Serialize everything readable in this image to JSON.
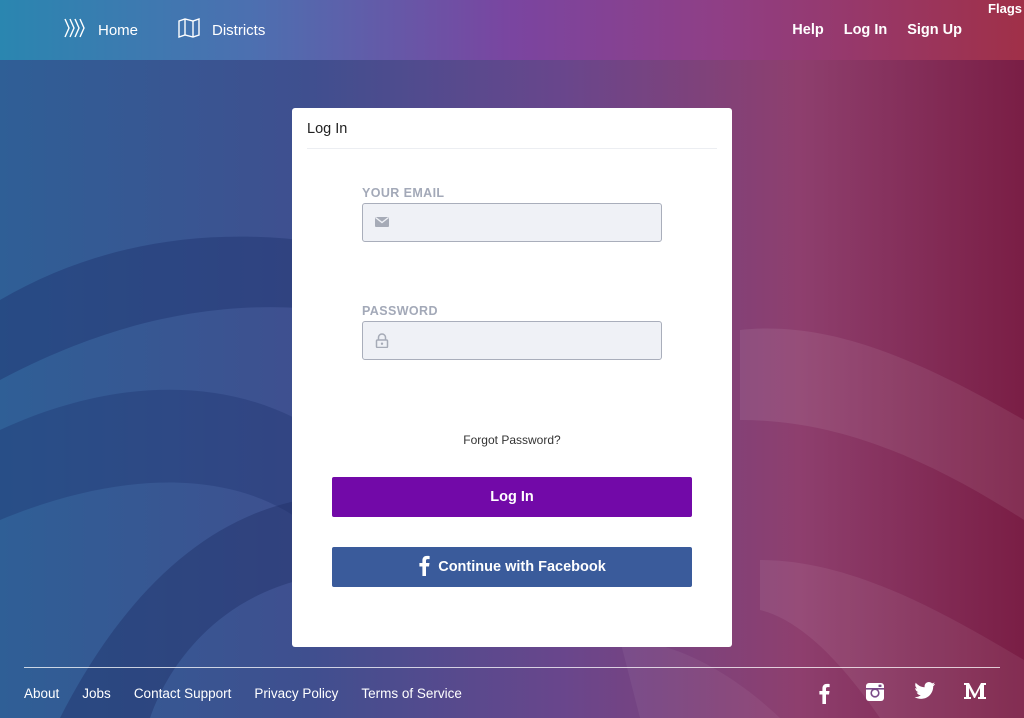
{
  "nav": {
    "home_label": "Home",
    "districts_label": "Districts",
    "help_label": "Help",
    "login_label": "Log In",
    "signup_label": "Sign Up",
    "flags_label": "Flags"
  },
  "login_card": {
    "title": "Log In",
    "email_label": "YOUR EMAIL",
    "email_value": "",
    "password_label": "PASSWORD",
    "password_value": "",
    "forgot_label": "Forgot Password?",
    "login_button": "Log In",
    "facebook_button": "Continue with Facebook"
  },
  "footer": {
    "links": [
      "About",
      "Jobs",
      "Contact Support",
      "Privacy Policy",
      "Terms of Service"
    ],
    "social_icons": [
      "facebook-icon",
      "instagram-icon",
      "twitter-icon",
      "medium-icon"
    ]
  },
  "colors": {
    "login_button": "#7209a8",
    "facebook_button": "#3a5b9b",
    "field_background": "#eff1f6"
  }
}
